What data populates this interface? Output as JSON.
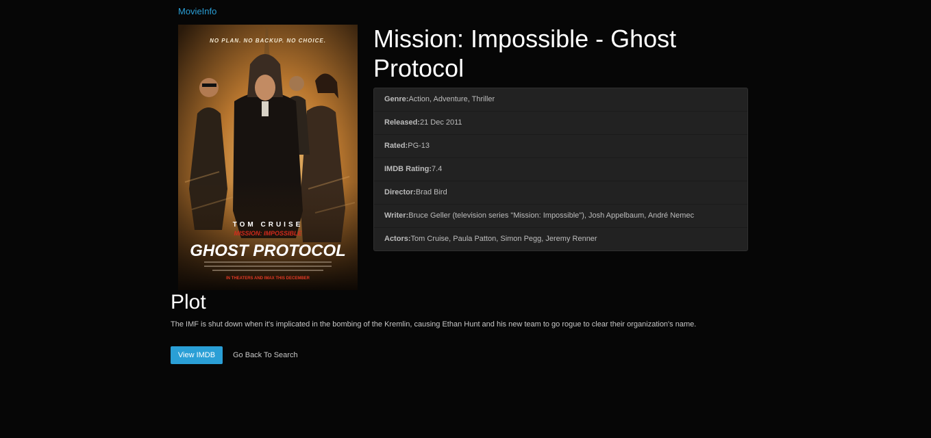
{
  "navbar": {
    "brand": "MovieInfo"
  },
  "movie": {
    "title": "Mission: Impossible - Ghost Protocol",
    "poster": {
      "tagline": "NO PLAN. NO BACKUP. NO CHOICE.",
      "actor_name": "TOM CRUISE",
      "franchise": "MISSION: IMPOSSIBLE",
      "logo": "GHOST PROTOCOL",
      "release_line": "IN THEATERS AND IMAX THIS DECEMBER"
    },
    "details": [
      {
        "label": "Genre:",
        "value": "Action, Adventure, Thriller"
      },
      {
        "label": "Released:",
        "value": "21 Dec 2011"
      },
      {
        "label": "Rated:",
        "value": "PG-13"
      },
      {
        "label": "IMDB Rating:",
        "value": "7.4"
      },
      {
        "label": "Director:",
        "value": "Brad Bird"
      },
      {
        "label": "Writer:",
        "value": "Bruce Geller (television series \"Mission: Impossible\"), Josh Appelbaum, André Nemec"
      },
      {
        "label": "Actors:",
        "value": "Tom Cruise, Paula Patton, Simon Pegg, Jeremy Renner"
      }
    ]
  },
  "plot": {
    "heading": "Plot",
    "text": "The IMF is shut down when it's implicated in the bombing of the Kremlin, causing Ethan Hunt and his new team to go rogue to clear their organization's name."
  },
  "actions": {
    "view_imdb": "View IMDB",
    "back": "Go Back To Search"
  },
  "colors": {
    "accent": "#2a9fd6",
    "background": "#060606",
    "panel": "#222222"
  }
}
